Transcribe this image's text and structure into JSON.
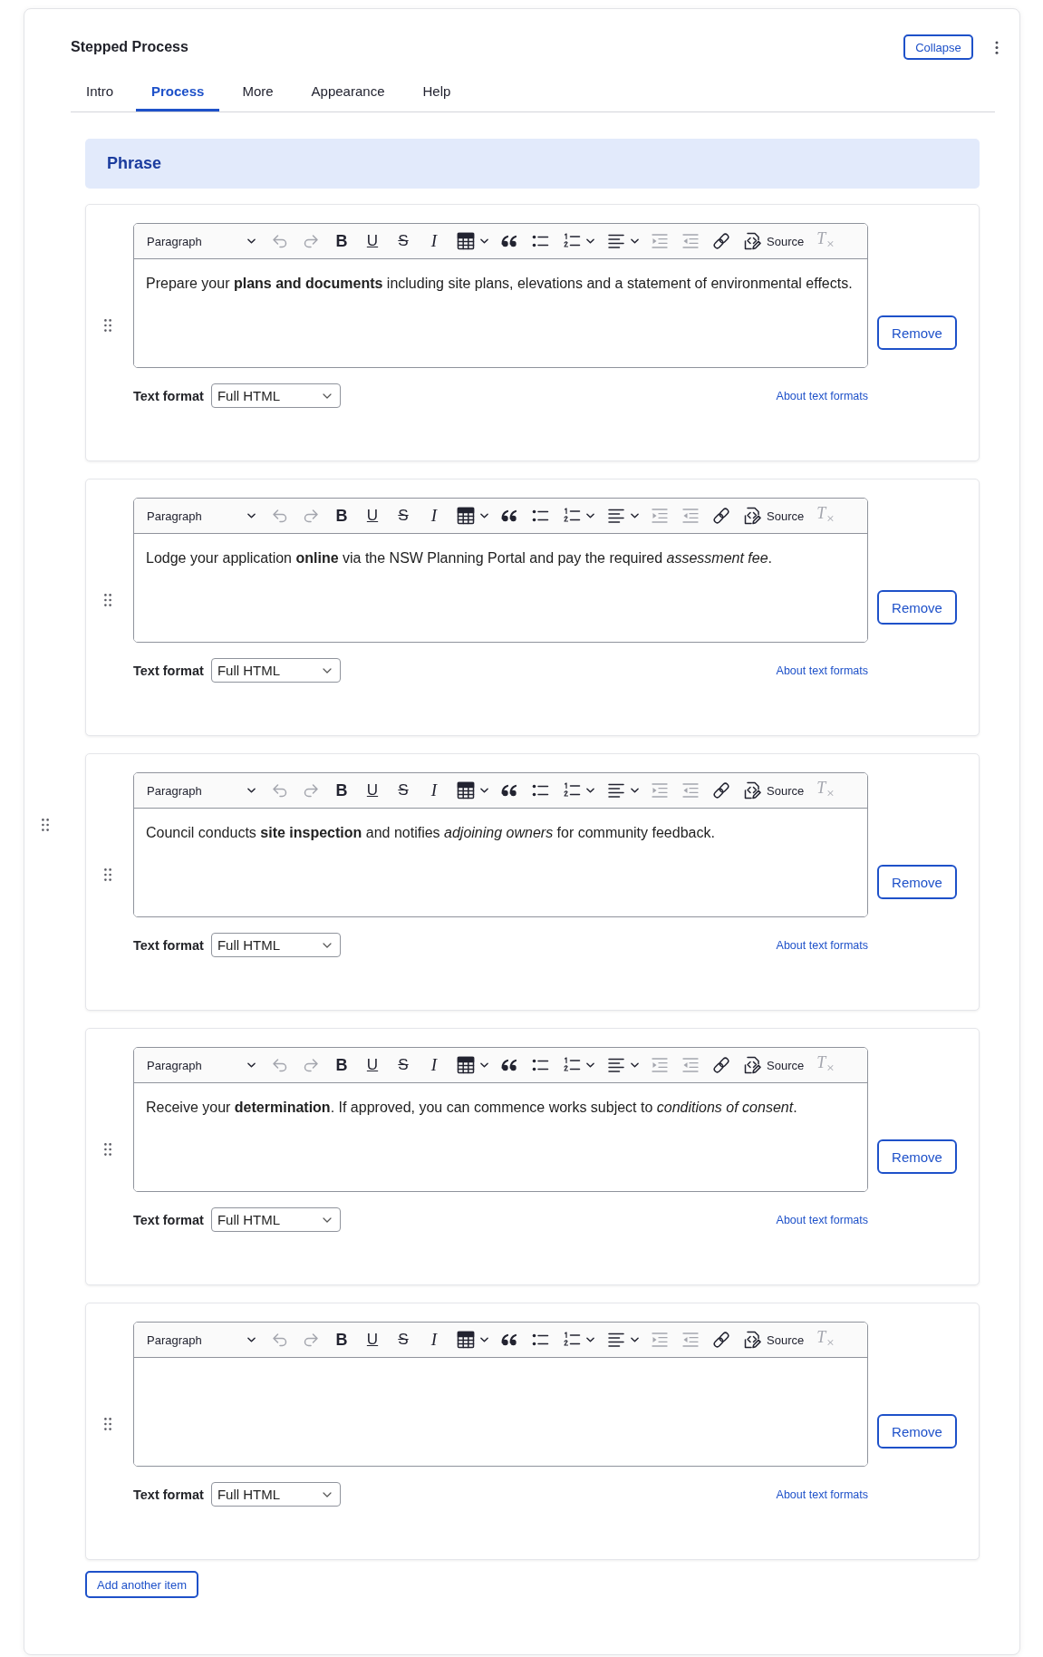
{
  "widget": {
    "title": "Stepped Process",
    "collapse_label": "Collapse"
  },
  "tabs": [
    {
      "label": "Intro",
      "selected": false
    },
    {
      "label": "Process",
      "selected": true
    },
    {
      "label": "More",
      "selected": false
    },
    {
      "label": "Appearance",
      "selected": false
    },
    {
      "label": "Help",
      "selected": false
    }
  ],
  "section": {
    "heading": "Phrase"
  },
  "items": [
    {
      "toolbar": {
        "block_format": "Paragraph",
        "buttons": [
          {
            "kind": "undo",
            "disabled": true,
            "menu": false
          },
          {
            "kind": "redo",
            "disabled": true,
            "menu": false
          },
          {
            "kind": "bold",
            "glyph": "B",
            "disabled": false,
            "menu": false
          },
          {
            "kind": "underline",
            "glyph": "U",
            "disabled": false,
            "menu": false
          },
          {
            "kind": "strike",
            "glyph": "S",
            "disabled": false,
            "menu": false
          },
          {
            "kind": "italic",
            "glyph": "I",
            "disabled": false,
            "menu": false
          },
          {
            "kind": "table",
            "disabled": false,
            "menu": true
          },
          {
            "kind": "quote",
            "disabled": false,
            "menu": false
          },
          {
            "kind": "bullets",
            "disabled": false,
            "menu": false
          },
          {
            "kind": "numbers",
            "disabled": false,
            "menu": true
          },
          {
            "kind": "align",
            "disabled": false,
            "menu": true
          },
          {
            "kind": "indent",
            "disabled": true,
            "menu": false
          },
          {
            "kind": "outdent",
            "disabled": true,
            "menu": false
          },
          {
            "kind": "link",
            "disabled": false,
            "menu": false
          },
          {
            "kind": "source",
            "label": "Source",
            "disabled": false,
            "menu": false
          },
          {
            "kind": "clear",
            "glyph": "T$_{×}$",
            "disabled": true,
            "menu": false
          }
        ]
      },
      "content": "Prepare your **plans and documents** including site plans, elevations and a statement of environmental effects.",
      "text_format": {
        "label": "Text format",
        "value": "Full HTML",
        "help_link": "About text formats"
      },
      "remove_label": "Remove"
    },
    {
      "toolbar": {
        "block_format": "Paragraph",
        "buttons": [
          {
            "kind": "undo",
            "disabled": true,
            "menu": false
          },
          {
            "kind": "redo",
            "disabled": true,
            "menu": false
          },
          {
            "kind": "bold",
            "glyph": "B",
            "disabled": false,
            "menu": false
          },
          {
            "kind": "underline",
            "glyph": "U",
            "disabled": false,
            "menu": false
          },
          {
            "kind": "strike",
            "glyph": "S",
            "disabled": false,
            "menu": false
          },
          {
            "kind": "italic",
            "glyph": "I",
            "disabled": false,
            "menu": false
          },
          {
            "kind": "table",
            "disabled": false,
            "menu": true
          },
          {
            "kind": "quote",
            "disabled": false,
            "menu": false
          },
          {
            "kind": "bullets",
            "disabled": false,
            "menu": false
          },
          {
            "kind": "numbers",
            "disabled": false,
            "menu": true
          },
          {
            "kind": "align",
            "disabled": false,
            "menu": true
          },
          {
            "kind": "indent",
            "disabled": true,
            "menu": false
          },
          {
            "kind": "outdent",
            "disabled": true,
            "menu": false
          },
          {
            "kind": "link",
            "disabled": false,
            "menu": false
          },
          {
            "kind": "source",
            "label": "Source",
            "disabled": false,
            "menu": false
          },
          {
            "kind": "clear",
            "glyph": "T$_{×}$",
            "disabled": true,
            "menu": false
          }
        ]
      },
      "content": "Lodge your application **online** via the NSW Planning Portal and pay the required *assessment fee*.",
      "text_format": {
        "label": "Text format",
        "value": "Full HTML",
        "help_link": "About text formats"
      },
      "remove_label": "Remove"
    },
    {
      "toolbar": {
        "block_format": "Paragraph",
        "buttons": [
          {
            "kind": "undo",
            "disabled": true,
            "menu": false
          },
          {
            "kind": "redo",
            "disabled": true,
            "menu": false
          },
          {
            "kind": "bold",
            "glyph": "B",
            "disabled": false,
            "menu": false
          },
          {
            "kind": "underline",
            "glyph": "U",
            "disabled": false,
            "menu": false
          },
          {
            "kind": "strike",
            "glyph": "S",
            "disabled": false,
            "menu": false
          },
          {
            "kind": "italic",
            "glyph": "I",
            "disabled": false,
            "menu": false
          },
          {
            "kind": "table",
            "disabled": false,
            "menu": true
          },
          {
            "kind": "quote",
            "disabled": false,
            "menu": false
          },
          {
            "kind": "bullets",
            "disabled": false,
            "menu": false
          },
          {
            "kind": "numbers",
            "disabled": false,
            "menu": true
          },
          {
            "kind": "align",
            "disabled": false,
            "menu": true
          },
          {
            "kind": "indent",
            "disabled": true,
            "menu": false
          },
          {
            "kind": "outdent",
            "disabled": true,
            "menu": false
          },
          {
            "kind": "link",
            "disabled": false,
            "menu": false
          },
          {
            "kind": "source",
            "label": "Source",
            "disabled": false,
            "menu": false
          },
          {
            "kind": "clear",
            "glyph": "T$_{×}$",
            "disabled": true,
            "menu": false
          }
        ]
      },
      "content": "Council conducts **site inspection** and notifies *adjoining owners* for community feedback.",
      "text_format": {
        "label": "Text format",
        "value": "Full HTML",
        "help_link": "About text formats"
      },
      "remove_label": "Remove"
    },
    {
      "toolbar": {
        "block_format": "Paragraph",
        "buttons": [
          {
            "kind": "undo",
            "disabled": true,
            "menu": false
          },
          {
            "kind": "redo",
            "disabled": true,
            "menu": false
          },
          {
            "kind": "bold",
            "glyph": "B",
            "disabled": false,
            "menu": false
          },
          {
            "kind": "underline",
            "glyph": "U",
            "disabled": false,
            "menu": false
          },
          {
            "kind": "strike",
            "glyph": "S",
            "disabled": false,
            "menu": false
          },
          {
            "kind": "italic",
            "glyph": "I",
            "disabled": false,
            "menu": false
          },
          {
            "kind": "table",
            "disabled": false,
            "menu": true
          },
          {
            "kind": "quote",
            "disabled": false,
            "menu": false
          },
          {
            "kind": "bullets",
            "disabled": false,
            "menu": false
          },
          {
            "kind": "numbers",
            "disabled": false,
            "menu": true
          },
          {
            "kind": "align",
            "disabled": false,
            "menu": true
          },
          {
            "kind": "indent",
            "disabled": true,
            "menu": false
          },
          {
            "kind": "outdent",
            "disabled": true,
            "menu": false
          },
          {
            "kind": "link",
            "disabled": false,
            "menu": false
          },
          {
            "kind": "source",
            "label": "Source",
            "disabled": false,
            "menu": false
          },
          {
            "kind": "clear",
            "glyph": "T$_{×}$",
            "disabled": true,
            "menu": false
          }
        ]
      },
      "content": "Receive your **determination**. If approved, you can commence works subject to *conditions of consent*.",
      "text_format": {
        "label": "Text format",
        "value": "Full HTML",
        "help_link": "About text formats"
      },
      "remove_label": "Remove"
    },
    {
      "toolbar": {
        "block_format": "Paragraph",
        "buttons": [
          {
            "kind": "undo",
            "disabled": true,
            "menu": false
          },
          {
            "kind": "redo",
            "disabled": true,
            "menu": false
          },
          {
            "kind": "bold",
            "glyph": "B",
            "disabled": false,
            "menu": false
          },
          {
            "kind": "underline",
            "glyph": "U",
            "disabled": false,
            "menu": false
          },
          {
            "kind": "strike",
            "glyph": "S",
            "disabled": false,
            "menu": false
          },
          {
            "kind": "italic",
            "glyph": "I",
            "disabled": false,
            "menu": false
          },
          {
            "kind": "table",
            "disabled": false,
            "menu": true
          },
          {
            "kind": "quote",
            "disabled": false,
            "menu": false
          },
          {
            "kind": "bullets",
            "disabled": false,
            "menu": false
          },
          {
            "kind": "numbers",
            "disabled": false,
            "menu": true
          },
          {
            "kind": "align",
            "disabled": false,
            "menu": true
          },
          {
            "kind": "indent",
            "disabled": true,
            "menu": false
          },
          {
            "kind": "outdent",
            "disabled": true,
            "menu": false
          },
          {
            "kind": "link",
            "disabled": false,
            "menu": false
          },
          {
            "kind": "source",
            "label": "Source",
            "disabled": false,
            "menu": false
          },
          {
            "kind": "clear",
            "glyph": "T$_{×}$",
            "disabled": true,
            "menu": false
          }
        ]
      },
      "text_format": {
        "label": "Text format",
        "value": "Full HTML",
        "help_link": "About text formats"
      },
      "remove_label": "Remove"
    }
  ],
  "add_button": "Add another item"
}
